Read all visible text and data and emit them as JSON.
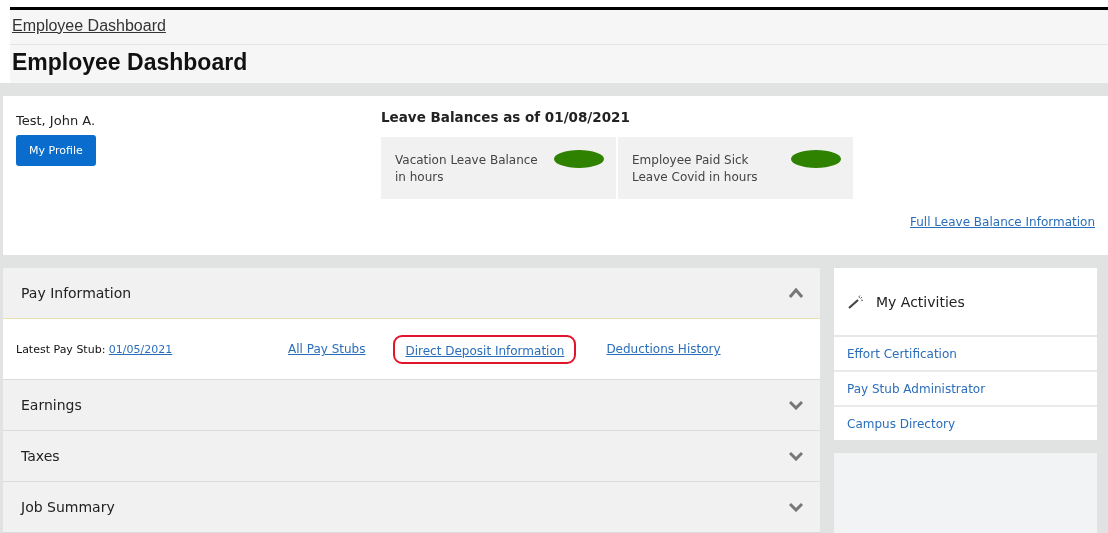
{
  "breadcrumb": "Employee Dashboard",
  "page_title": "Employee Dashboard",
  "profile": {
    "name": "Test, John A.",
    "button": "My Profile"
  },
  "leave_balances": {
    "title": "Leave Balances as of 01/08/2021",
    "items": [
      {
        "label": "Vacation Leave Balance in hours",
        "redacted": true
      },
      {
        "label": "Employee Paid Sick Leave Covid in hours",
        "redacted": true
      }
    ],
    "link": "Full Leave Balance Information"
  },
  "sections": [
    {
      "title": "Pay Information",
      "expanded": true,
      "content": {
        "label": "Latest Pay Stub:",
        "date_link": "01/05/2021",
        "links": [
          {
            "text": "All Pay Stubs",
            "highlighted": false
          },
          {
            "text": "Direct Deposit Information",
            "highlighted": true
          },
          {
            "text": "Deductions History",
            "highlighted": false
          }
        ]
      }
    },
    {
      "title": "Earnings",
      "expanded": false
    },
    {
      "title": "Taxes",
      "expanded": false
    },
    {
      "title": "Job Summary",
      "expanded": false
    }
  ],
  "activities": {
    "title": "My Activities",
    "items": [
      "Effort Certification",
      "Pay Stub Administrator",
      "Campus Directory"
    ]
  }
}
